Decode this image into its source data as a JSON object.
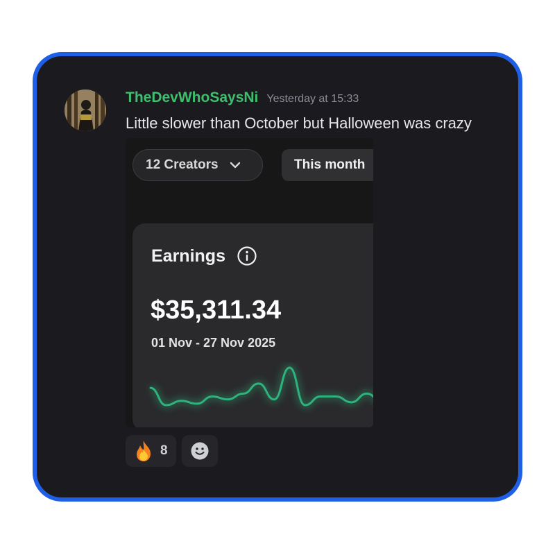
{
  "message": {
    "author": "TheDevWhoSaysNi",
    "timestamp": "Yesterday at 15:33",
    "text": "Little slower than October but Halloween was crazy",
    "author_color": "#3fbf6e"
  },
  "embed": {
    "creators_filter": "12 Creators",
    "period_filter": "This month",
    "card": {
      "title": "Earnings",
      "amount": "$35,311.34",
      "date_range": "01 Nov - 27 Nov 2025",
      "sparkline": {
        "type": "line",
        "values": [
          34,
          22,
          25,
          23,
          28,
          26,
          30,
          37,
          26,
          48,
          22,
          28,
          28,
          24,
          30,
          24
        ],
        "color": "#2fb27d"
      }
    }
  },
  "reactions": [
    {
      "emoji": "🔥",
      "count": "8",
      "icon": "fire-emoji"
    }
  ],
  "add_reaction_icon": "smiley-icon",
  "frame_color": "#1f5fe6"
}
